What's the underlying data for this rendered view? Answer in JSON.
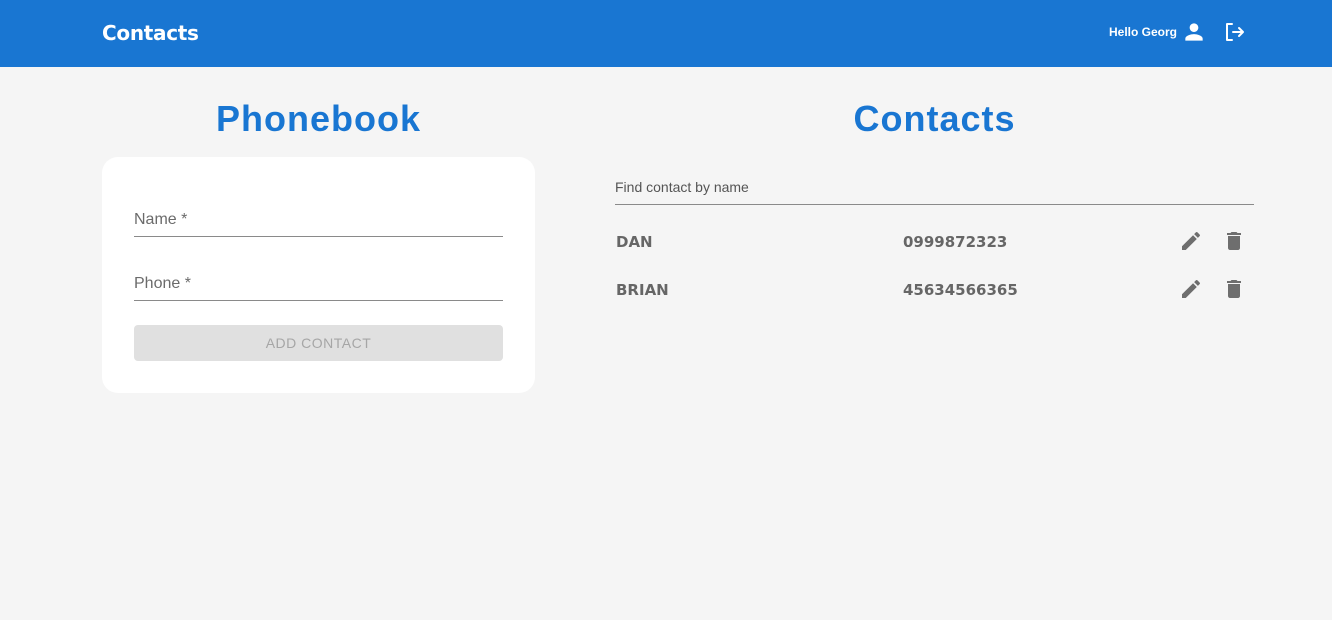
{
  "header": {
    "app_title": "Contacts",
    "greeting": "Hello Georg",
    "user_icon": "person-icon",
    "logout_icon": "logout-icon",
    "background_color": "#1976d2"
  },
  "phonebook": {
    "title": "Phonebook",
    "name_placeholder": "Name *",
    "phone_placeholder": "Phone *",
    "add_button_label": "ADD CONTACT"
  },
  "contacts": {
    "title": "Contacts",
    "filter_placeholder": "Find contact by name",
    "items": [
      {
        "name": "DAN",
        "phone": "0999872323"
      },
      {
        "name": "BRIAN",
        "phone": "45634566365"
      }
    ],
    "edit_icon": "pencil-icon",
    "delete_icon": "trash-icon"
  },
  "colors": {
    "accent": "#1976d2",
    "page_background": "#f5f5f5",
    "card_background": "#ffffff",
    "disabled_button": "#e0e0e0",
    "icon_gray": "#6e6e6e"
  }
}
